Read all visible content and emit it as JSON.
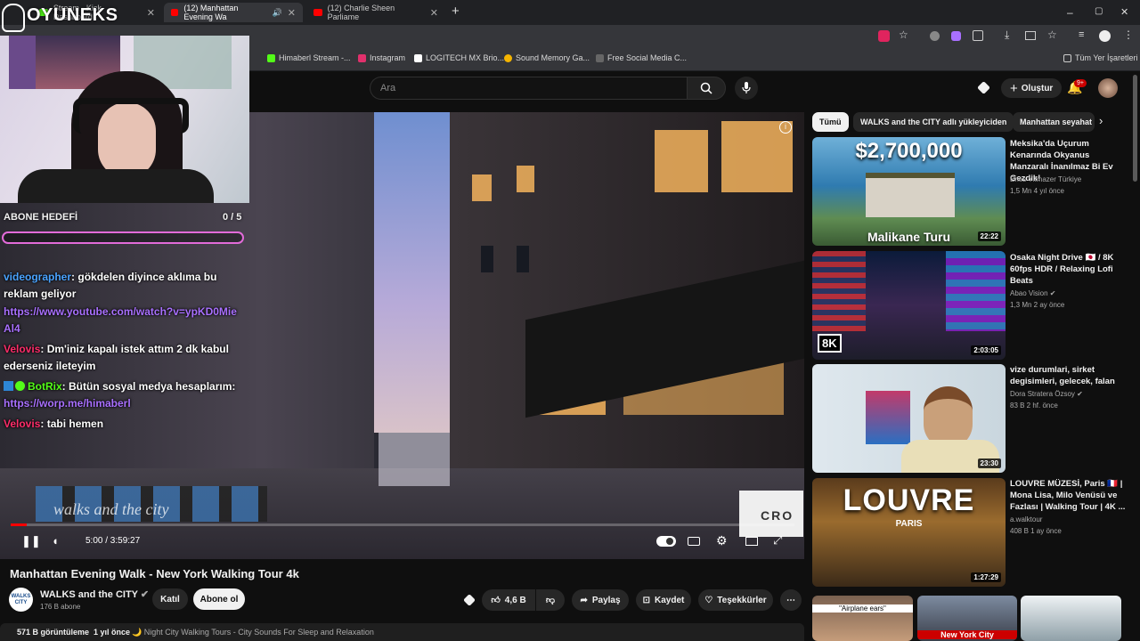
{
  "browser": {
    "tabs": [
      {
        "title": "Stream - Kick Dashboard",
        "color": "#53fc18"
      },
      {
        "title": "(12) Manhattan Evening Wa",
        "color": "#ff0000"
      },
      {
        "title": "(12) Charlie Sheen Parliame",
        "color": "#ff0000"
      }
    ],
    "new_tab": "+",
    "window_controls": [
      "–",
      "▢",
      "✕"
    ],
    "bookmarks": [
      {
        "label": "Himaberl Stream -...",
        "color": "#53fc18"
      },
      {
        "label": "Instagram",
        "color": "#e1306c"
      },
      {
        "label": "LOGITECH MX Brio...",
        "color": "#ffffff"
      },
      {
        "label": "Sound Memory Ga...",
        "color": "#f4b400"
      },
      {
        "label": "Free Social Media C...",
        "color": "#444444"
      }
    ],
    "all_bookmarks": "Tüm Yer İşaretleri"
  },
  "overlay": {
    "logo": "OYUNEKS",
    "goal_label": "ABONE HEDEFİ",
    "goal_count": "0 / 5",
    "goal_progress": 0,
    "chat": [
      {
        "user": "videographer",
        "user_color": "#4aa3ff",
        "text": ": gökdelen diyince aklıma bu reklam geliyor"
      },
      {
        "user": "",
        "user_color": "#a970ff",
        "text": "https://www.youtube.com/watch?v=ypKD0MieAl4"
      },
      {
        "user": "Velovis",
        "user_color": "#ff2d6a",
        "text": ": Dm'iniz kapalı istek attım 2 dk kabul ederseniz ileteyim"
      },
      {
        "user": "BotRix",
        "user_color": "#53fc18",
        "text": ": Bütün sosyal medya hesaplarım:"
      },
      {
        "user": "",
        "user_color": "#a970ff",
        "text": "https://worp.me/himaberl"
      },
      {
        "user": "Velovis",
        "user_color": "#ff2d6a",
        "text": ": tabi hemen"
      }
    ]
  },
  "youtube": {
    "search_placeholder": "Ara",
    "create_label": "Oluştur",
    "notif_count": "9+",
    "player": {
      "time": "5:00 / 3:59:27",
      "progress": 0.021,
      "watermark": "walks and the city"
    },
    "video": {
      "title": "Manhattan Evening Walk - New York Walking Tour 4k",
      "channel": "WALKS and the CITY",
      "channel_avatar": "WALKS CITY",
      "subs": "176 B abone",
      "join": "Katıl",
      "subscribe": "Abone ol",
      "likes": "4,6 B",
      "share": "Paylaş",
      "save": "Kaydet",
      "thanks": "Teşekkürler",
      "views": "571 B görüntüleme",
      "ago": "1 yıl önce",
      "desc": "🌙 Night City Walking Tours - City Sounds For Sleep and Relaxation"
    },
    "chips": [
      "Tümü",
      "WALKS and the CITY adlı yükleyiciden",
      "Manhattan seyahat"
    ],
    "recommended": [
      {
        "title": "Meksika'da Uçurum Kenarında Okyanus Manzaralı İnanılmaz Bi Ev Gezdik!",
        "channel": "Enes Yılmazer Türkiye",
        "meta": "1,5 Mn  4 yıl önce",
        "duration": "22:22",
        "overlay_top": "$2,700,000",
        "overlay_bottom": "Malikane Turu",
        "verified": false
      },
      {
        "title": "Osaka Night Drive 🇯🇵 / 8K 60fps HDR / Relaxing Lofi Beats",
        "channel": "Abao Vision",
        "meta": "1,3 Mn  2 ay önce",
        "duration": "2:03:05",
        "overlay_top": "",
        "overlay_bottom": "8K",
        "verified": true
      },
      {
        "title": "vize durumlari, sirket degisimleri, gelecek, falan",
        "channel": "Dora Stratera Özsoy",
        "meta": "83 B  2 hf. önce",
        "duration": "23:30",
        "overlay_top": "",
        "overlay_bottom": "",
        "verified": true
      },
      {
        "title": "LOUVRE MÜZESİ, Paris 🇫🇷 | Mona Lisa, Milo Venüsü ve Fazlası | Walking Tour | 4K ...",
        "channel": "a.walktour",
        "meta": "408 B  1 ay önce",
        "duration": "1:27:29",
        "overlay_top": "LOUVRE",
        "overlay_bottom": "PARIS",
        "verified": false
      }
    ],
    "shorts": [
      "\"Airplane ears\"",
      "New York City",
      ""
    ]
  }
}
